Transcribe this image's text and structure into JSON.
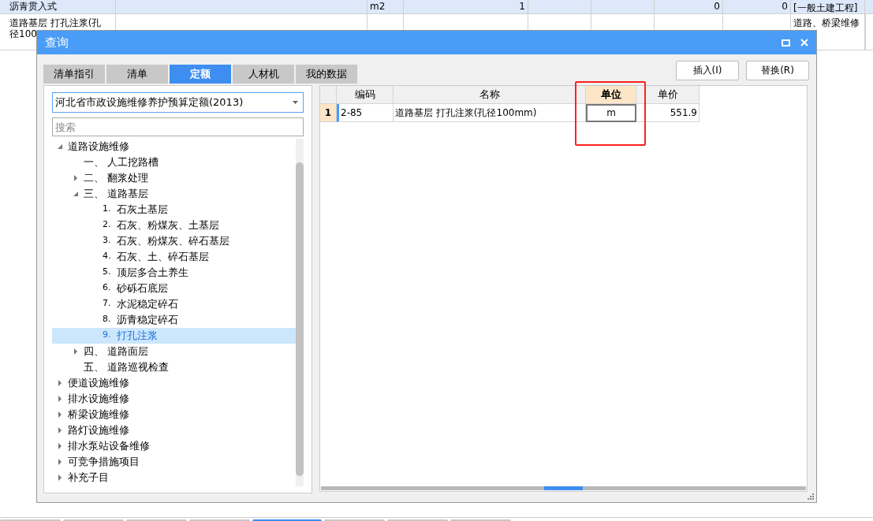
{
  "background_table": {
    "rows": [
      {
        "selected": true,
        "cells": [
          "沥青贯入式",
          "",
          "m2",
          "1",
          "",
          "",
          "0",
          "0",
          "[一般土建工程]",
          ""
        ]
      },
      {
        "selected": false,
        "cells": [
          "道路基层 打孔注浆(孔径100",
          "",
          "",
          "",
          "",
          "",
          "",
          "",
          "道路、桥梁维修",
          ""
        ]
      }
    ]
  },
  "dialog": {
    "title": "查询",
    "tabs": [
      {
        "label": "清单指引",
        "selected": false
      },
      {
        "label": "清单",
        "selected": false
      },
      {
        "label": "定额",
        "selected": true
      },
      {
        "label": "人材机",
        "selected": false
      },
      {
        "label": "我的数据",
        "selected": false
      }
    ],
    "buttons": [
      "插入(I)",
      "替换(R)"
    ],
    "library": {
      "value": "河北省市政设施维修养护预算定额(2013)"
    },
    "search": {
      "placeholder": "搜索"
    },
    "tree": [
      {
        "label": "道路设施维修",
        "expandable": true,
        "expanded": true,
        "selected": false,
        "children": [
          {
            "number": "一、",
            "label": "人工挖路槽",
            "expandable": false,
            "expanded": false,
            "selected": false
          },
          {
            "number": "二、",
            "label": "翻浆处理",
            "expandable": true,
            "expanded": false,
            "selected": false
          },
          {
            "number": "三、",
            "label": "道路基层",
            "expandable": true,
            "expanded": true,
            "selected": false,
            "children": [
              {
                "number": "1.",
                "label": "石灰土基层",
                "expandable": false,
                "expanded": false,
                "selected": false
              },
              {
                "number": "2.",
                "label": "石灰、粉煤灰、土基层",
                "expandable": false,
                "expanded": false,
                "selected": false
              },
              {
                "number": "3.",
                "label": "石灰、粉煤灰、碎石基层",
                "expandable": false,
                "expanded": false,
                "selected": false
              },
              {
                "number": "4.",
                "label": "石灰、土、碎石基层",
                "expandable": false,
                "expanded": false,
                "selected": false
              },
              {
                "number": "5.",
                "label": "顶层多合土养生",
                "expandable": false,
                "expanded": false,
                "selected": false
              },
              {
                "number": "6.",
                "label": "砂砾石底层",
                "expandable": false,
                "expanded": false,
                "selected": false
              },
              {
                "number": "7.",
                "label": "水泥稳定碎石",
                "expandable": false,
                "expanded": false,
                "selected": false
              },
              {
                "number": "8.",
                "label": "沥青稳定碎石",
                "expandable": false,
                "expanded": false,
                "selected": false
              },
              {
                "number": "9.",
                "label": "打孔注浆",
                "expandable": false,
                "expanded": false,
                "selected": true
              }
            ]
          },
          {
            "number": "四、",
            "label": "道路面层",
            "expandable": true,
            "expanded": false,
            "selected": false
          },
          {
            "number": "五、",
            "label": "道路巡视检查",
            "expandable": false,
            "expanded": false,
            "selected": false
          }
        ]
      },
      {
        "label": "便道设施维修",
        "expandable": true,
        "expanded": false,
        "selected": false
      },
      {
        "label": "排水设施维修",
        "expandable": true,
        "expanded": false,
        "selected": false
      },
      {
        "label": "桥梁设施维修",
        "expandable": true,
        "expanded": false,
        "selected": false
      },
      {
        "label": "路灯设施维修",
        "expandable": true,
        "expanded": false,
        "selected": false
      },
      {
        "label": "排水泵站设备维修",
        "expandable": true,
        "expanded": false,
        "selected": false
      },
      {
        "label": "可竞争措施项目",
        "expandable": true,
        "expanded": false,
        "selected": false
      },
      {
        "label": "补充子目",
        "expandable": true,
        "expanded": false,
        "selected": false
      }
    ],
    "grid": {
      "columns": [
        {
          "label": "编码",
          "selected": false
        },
        {
          "label": "名称",
          "selected": false
        },
        {
          "label": "单位",
          "selected": true
        },
        {
          "label": "单价",
          "selected": false
        }
      ],
      "rows": [
        {
          "number": "1",
          "selected": true,
          "cells": [
            "2-85",
            "道路基层 打孔注浆(孔径100mm)",
            "m",
            "551.9"
          ]
        }
      ]
    }
  },
  "bottom_tabs": [
    {
      "selected": false
    },
    {
      "selected": false
    },
    {
      "selected": false
    },
    {
      "selected": false
    },
    {
      "selected": true
    },
    {
      "selected": false
    },
    {
      "selected": false
    },
    {
      "selected": false
    }
  ]
}
